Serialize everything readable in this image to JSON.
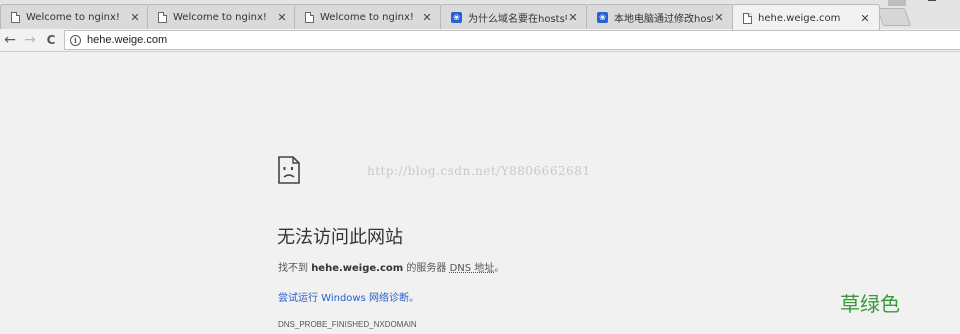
{
  "tabs": [
    {
      "title": "Welcome to nginx!",
      "favicon": "page-icon",
      "close": "✕"
    },
    {
      "title": "Welcome to nginx!",
      "favicon": "page-icon",
      "close": "✕"
    },
    {
      "title": "Welcome to nginx!",
      "favicon": "page-icon",
      "close": "✕"
    },
    {
      "title": "为什么域名要在hosts中",
      "favicon": "paw-icon",
      "close": "✕"
    },
    {
      "title": "本地电脑通过修改hosts",
      "favicon": "paw-icon",
      "close": "✕"
    },
    {
      "title": "hehe.weige.com",
      "favicon": "page-icon",
      "close": "✕",
      "active": true
    }
  ],
  "toolbar": {
    "back": "←",
    "forward": "→",
    "reload": "C",
    "info": "i",
    "url": "hehe.weige.com"
  },
  "error": {
    "watermark": "http://blog.csdn.net/Y8806662681",
    "heading": "无法访问此网站",
    "desc_prefix": "找不到 ",
    "desc_host": "hehe.weige.com",
    "desc_middle": " 的服务器 ",
    "desc_dns": "DNS 地址",
    "desc_suffix": "。",
    "diagnose_link": "尝试运行 Windows 网络诊断。",
    "error_code": "DNS_PROBE_FINISHED_NXDOMAIN"
  },
  "corner_note": "草绿色",
  "colors": {
    "link": "#2461c8",
    "corner_note": "#3a9a3a",
    "paw_favicon": "#2b5fd3"
  }
}
